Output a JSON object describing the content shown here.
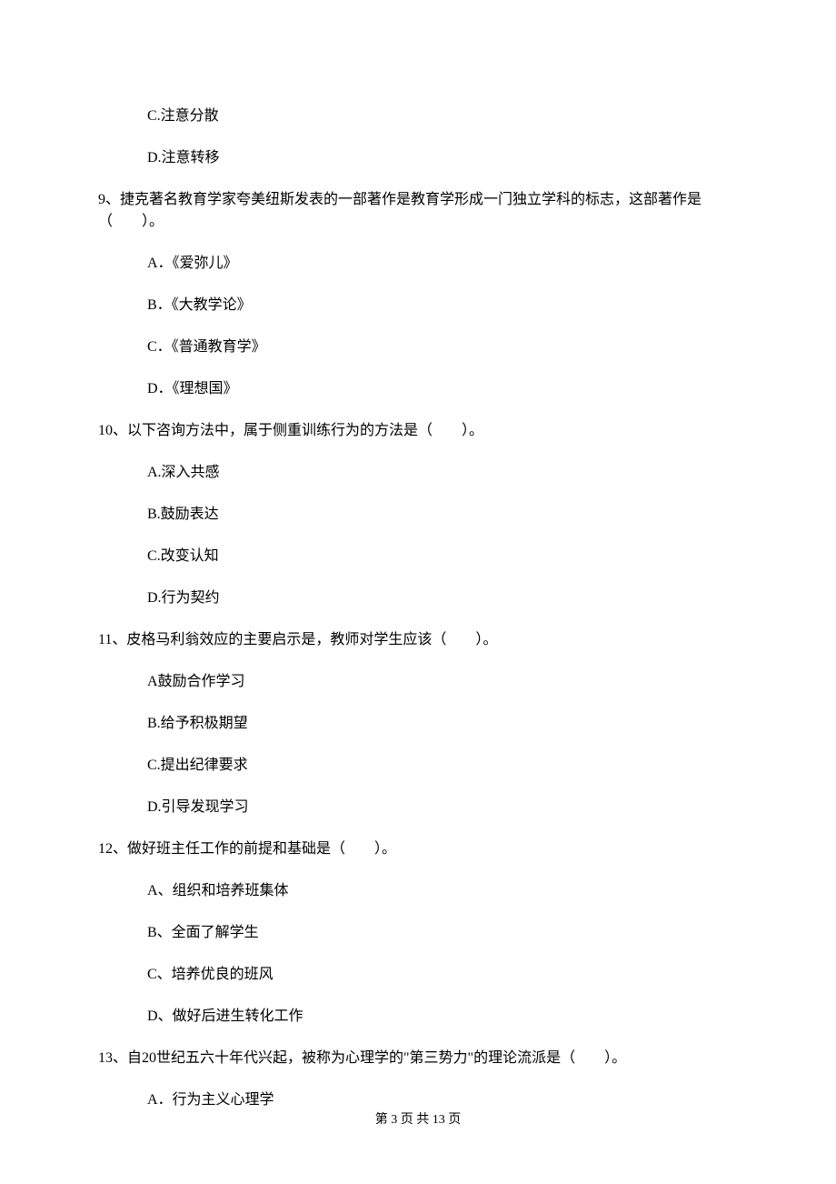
{
  "pre_options": {
    "c": "C.注意分散",
    "d": "D.注意转移"
  },
  "q9": {
    "stem": "9、捷克著名教育学家夸美纽斯发表的一部著作是教育学形成一门独立学科的标志，这部著作是（　　）。",
    "a": "A．《爱弥儿》",
    "b": "B．《大教学论》",
    "c": "C．《普通教育学》",
    "d": "D．《理想国》"
  },
  "q10": {
    "stem": "10、以下咨询方法中，属于侧重训练行为的方法是（　　）。",
    "a": "A.深入共感",
    "b": "B.鼓励表达",
    "c": "C.改变认知",
    "d": "D.行为契约"
  },
  "q11": {
    "stem": "11、皮格马利翁效应的主要启示是，教师对学生应该（　　）。",
    "a": "A鼓励合作学习",
    "b": "B.给予积极期望",
    "c": "C.提出纪律要求",
    "d": "D.引导发现学习"
  },
  "q12": {
    "stem": "12、做好班主任工作的前提和基础是（　　）。",
    "a": "A、组织和培养班集体",
    "b": "B、全面了解学生",
    "c": "C、培养优良的班风",
    "d": "D、做好后进生转化工作"
  },
  "q13": {
    "stem": "13、自20世纪五六十年代兴起，被称为心理学的\"第三势力\"的理论流派是（　　）。",
    "a": "A．行为主义心理学"
  },
  "footer": "第 3 页 共 13 页"
}
